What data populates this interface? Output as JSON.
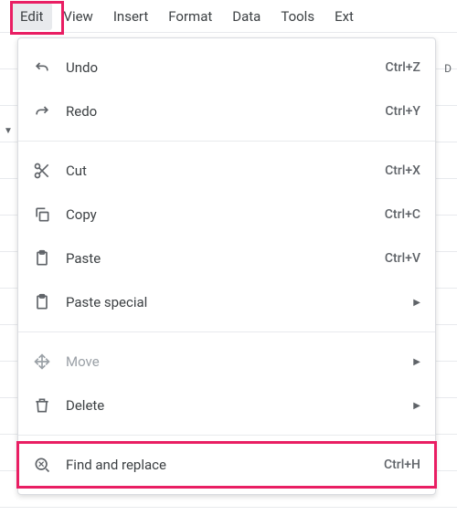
{
  "menubar": {
    "items": [
      "Edit",
      "View",
      "Insert",
      "Format",
      "Data",
      "Tools",
      "Ext"
    ]
  },
  "dropdown": {
    "undo": {
      "label": "Undo",
      "shortcut": "Ctrl+Z"
    },
    "redo": {
      "label": "Redo",
      "shortcut": "Ctrl+Y"
    },
    "cut": {
      "label": "Cut",
      "shortcut": "Ctrl+X"
    },
    "copy": {
      "label": "Copy",
      "shortcut": "Ctrl+C"
    },
    "paste": {
      "label": "Paste",
      "shortcut": "Ctrl+V"
    },
    "paste_special": {
      "label": "Paste special"
    },
    "move": {
      "label": "Move"
    },
    "delete": {
      "label": "Delete"
    },
    "find_replace": {
      "label": "Find and replace",
      "shortcut": "Ctrl+H"
    }
  },
  "column_letter": "D"
}
